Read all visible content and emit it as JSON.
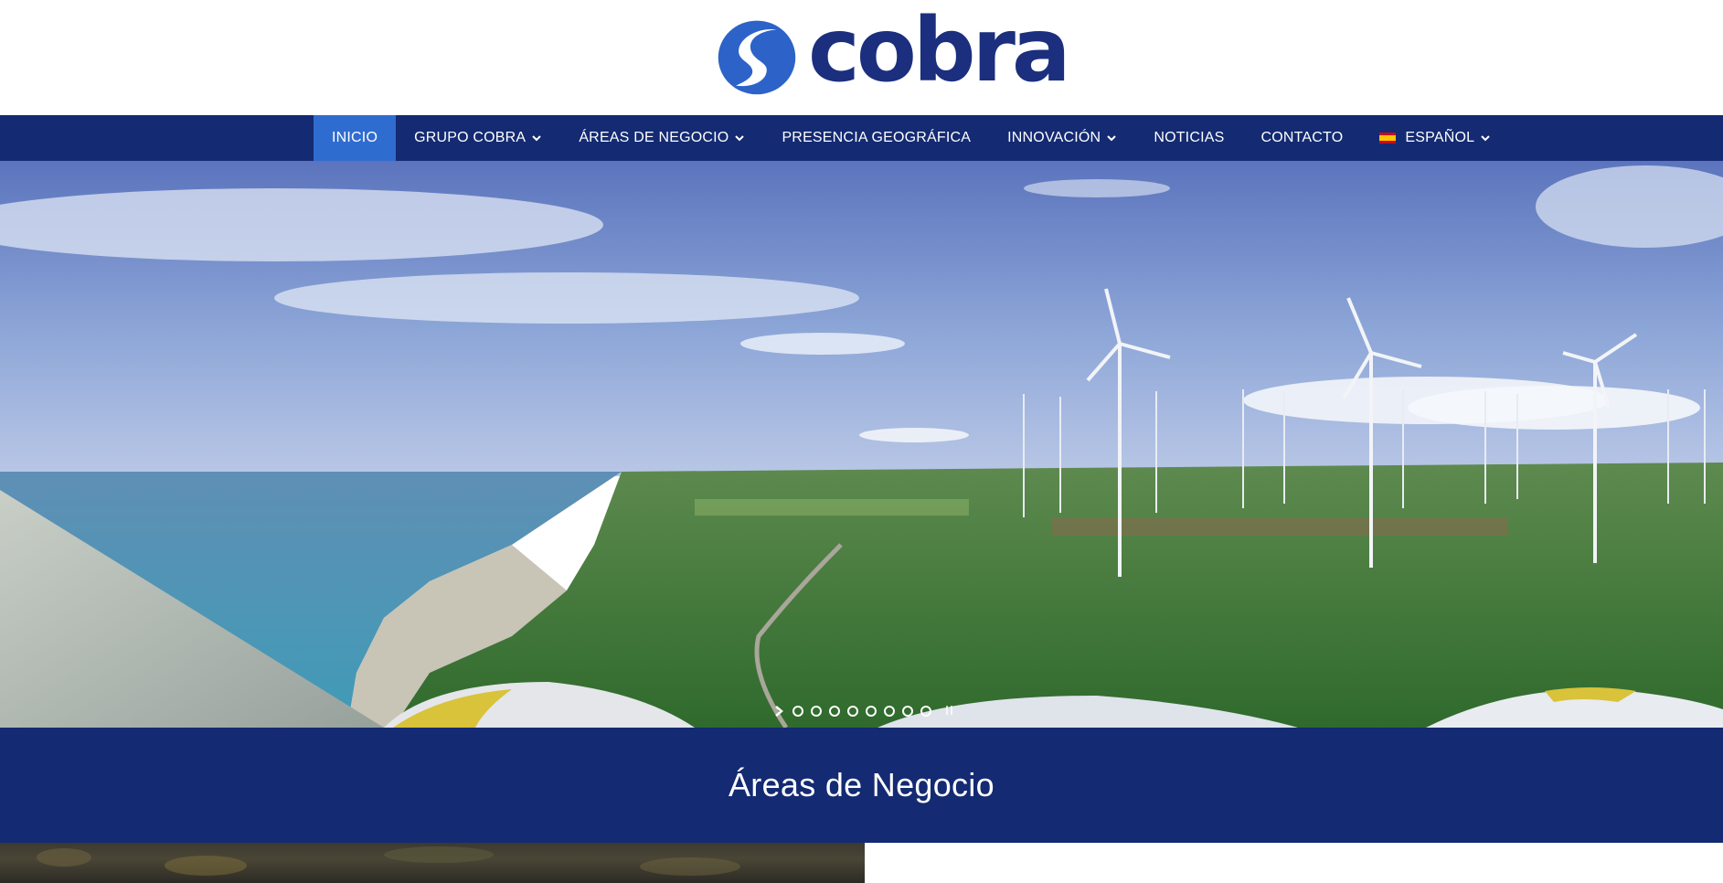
{
  "brand": {
    "name": "cobra",
    "logo_icon": "cobra-swirl-logo",
    "color_primary": "#1b2f7e",
    "color_accent": "#2d63c8"
  },
  "nav": {
    "background": "#142a72",
    "active_color": "#2f6ccf",
    "items": [
      {
        "label": "INICIO",
        "active": true,
        "has_dropdown": false
      },
      {
        "label": "GRUPO COBRA",
        "active": false,
        "has_dropdown": true
      },
      {
        "label": "ÁREAS DE NEGOCIO",
        "active": false,
        "has_dropdown": true
      },
      {
        "label": "PRESENCIA GEOGRÁFICA",
        "active": false,
        "has_dropdown": false
      },
      {
        "label": "INNOVACIÓN",
        "active": false,
        "has_dropdown": true
      },
      {
        "label": "NOTICIAS",
        "active": false,
        "has_dropdown": false
      },
      {
        "label": "CONTACTO",
        "active": false,
        "has_dropdown": false
      }
    ],
    "language": {
      "label": "ESPAÑOL",
      "flag_icon": "spain-flag-icon",
      "has_dropdown": true
    }
  },
  "hero": {
    "image_subject": "coastal wind farm viewed from a wind turbine nacelle",
    "slide_count": 8,
    "current_slide": 1,
    "next_icon": "chevron-right-icon",
    "pause_icon": "pause-icon"
  },
  "section": {
    "title": "Áreas de Negocio"
  }
}
